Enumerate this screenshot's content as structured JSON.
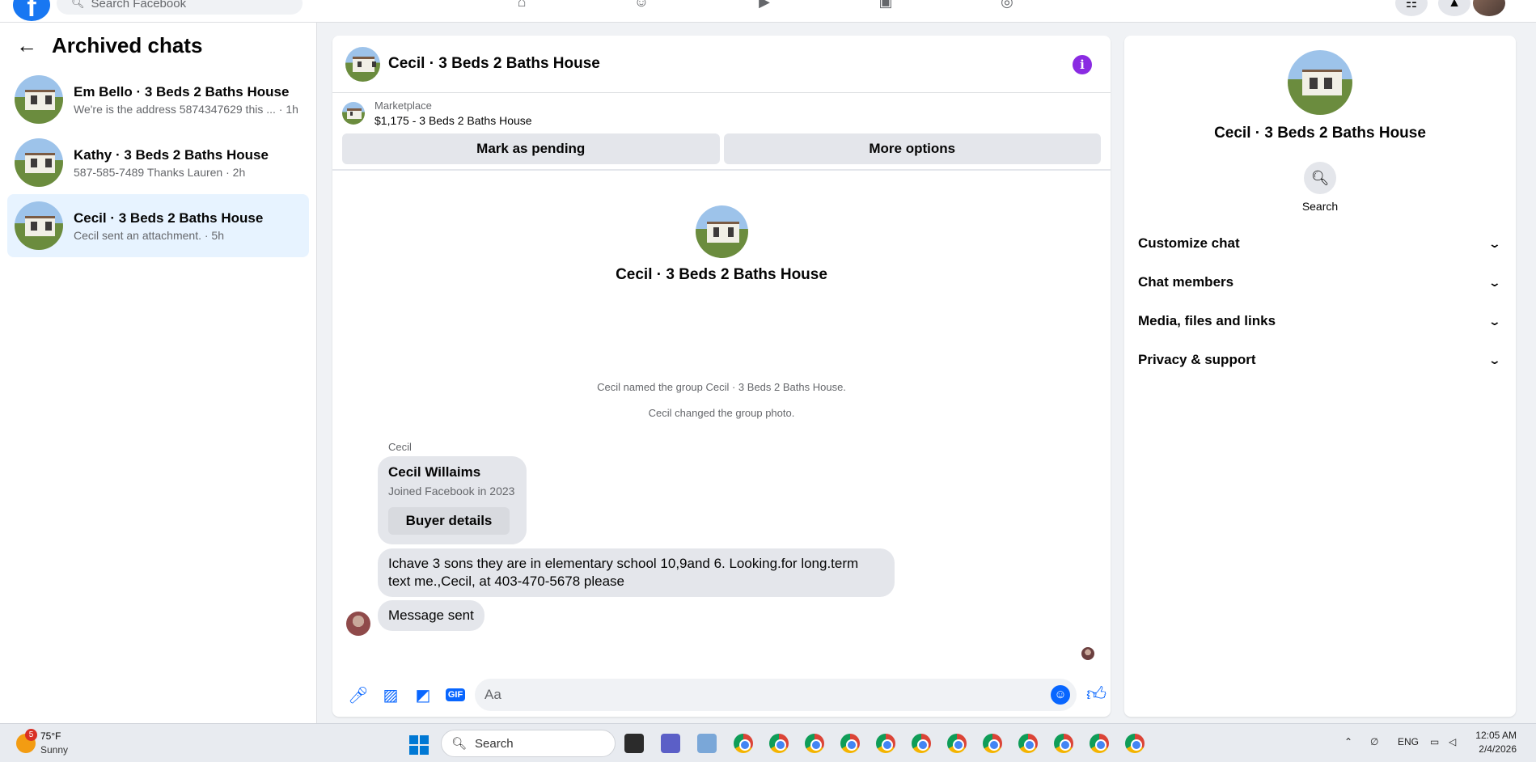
{
  "topbar": {
    "logo": "f",
    "search_placeholder": "Search Facebook"
  },
  "left": {
    "title": "Archived chats",
    "chats": [
      {
        "name": "Em Bello · 3 Beds 2 Baths House",
        "preview": "We're is the address 5874347629 this ... · 1h"
      },
      {
        "name": "Kathy · 3 Beds 2 Baths House",
        "preview": "587-585-7489 Thanks Lauren · 2h"
      },
      {
        "name": "Cecil · 3 Beds 2 Baths House",
        "preview": "Cecil sent an attachment. · 5h"
      }
    ]
  },
  "conversation": {
    "title": "Cecil · 3 Beds 2 Baths House",
    "marketplace_label": "Marketplace",
    "listing": "$1,175 - 3 Beds 2 Baths House",
    "mark_pending": "Mark as pending",
    "more_options": "More options",
    "intro_name": "Cecil · 3 Beds 2 Baths House",
    "system_1": "Cecil named the group Cecil · 3 Beds 2 Baths House.",
    "system_2": "Cecil changed the group photo.",
    "sender": "Cecil",
    "card_name": "Cecil Willaims",
    "card_sub": "Joined Facebook in 2023",
    "card_button": "Buyer details",
    "message_1": "Ichave 3 sons they are in elementary school 10,9and 6. Looking.for long.term text me.,Cecil, at 403-470-5678 please",
    "message_2": "Message sent",
    "composer_placeholder": "Aa"
  },
  "info_panel": {
    "name": "Cecil · 3 Beds 2 Baths House",
    "search_label": "Search",
    "sections": [
      "Customize chat",
      "Chat members",
      "Media, files and links",
      "Privacy & support"
    ]
  },
  "taskbar": {
    "weather_badge": "5",
    "temperature": "75°F",
    "condition": "Sunny",
    "search": "Search",
    "language": "ENG",
    "time": "12:05 AM",
    "date": "2/4/2026"
  },
  "colors": {
    "accent": "#0866ff",
    "active_chat": "#e7f3ff",
    "info_icon": "#8a2be2"
  }
}
